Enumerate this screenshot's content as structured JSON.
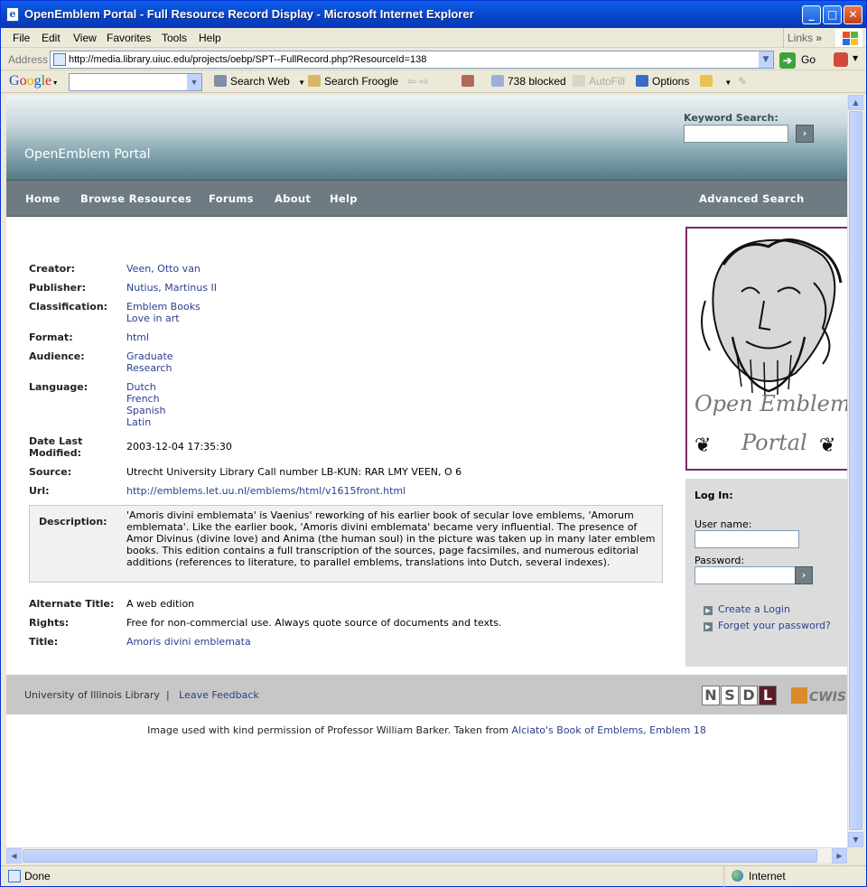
{
  "window": {
    "title": "OpenEmblem Portal - Full Resource Record Display - Microsoft Internet Explorer"
  },
  "menu": [
    "File",
    "Edit",
    "View",
    "Favorites",
    "Tools",
    "Help"
  ],
  "links_label": "Links",
  "address": {
    "label": "Address",
    "url": "http://media.library.uiuc.edu/projects/oebp/SPT--FullRecord.php?ResourceId=138",
    "go_label": "Go"
  },
  "google_toolbar": {
    "logo": "Google",
    "search_web": "Search Web",
    "search_froogle": "Search Froogle",
    "blocked": "738 blocked",
    "autofill": "AutoFill",
    "options": "Options"
  },
  "page": {
    "site_title": "OpenEmblem Portal",
    "keyword_search_label": "Keyword Search:",
    "nav": [
      "Home",
      "Browse Resources",
      "Forums",
      "About",
      "Help"
    ],
    "advanced_search": "Advanced Search",
    "record": {
      "creator_label": "Creator:",
      "creator": "Veen, Otto van",
      "publisher_label": "Publisher:",
      "publisher": "Nutius, Martinus II",
      "classification_label": "Classification:",
      "classification": [
        "Emblem Books",
        "Love in art"
      ],
      "format_label": "Format:",
      "format": "html",
      "audience_label": "Audience:",
      "audience": [
        "Graduate",
        "Research"
      ],
      "language_label": "Language:",
      "language": [
        "Dutch",
        "French",
        "Spanish",
        "Latin"
      ],
      "date_label_1": "Date Last",
      "date_label_2": "Modified:",
      "date": "2003-12-04 17:35:30",
      "source_label": "Source:",
      "source": "Utrecht University Library Call number LB-KUN: RAR LMY VEEN, O 6",
      "url_label": "Url:",
      "url": "http://emblems.let.uu.nl/emblems/html/v1615front.html",
      "description_label": "Description:",
      "description": "'Amoris divini emblemata' is Vaenius' reworking of his earlier book of secular love emblems, 'Amorum emblemata'. Like the earlier book, 'Amoris divini emblemata' became very influential. The presence of Amor Divinus (divine love) and Anima (the human soul) in the picture was taken up in many later emblem books. This edition contains a full transcription of the sources, page facsimiles, and numerous editorial additions (references to literature, to parallel emblems, translations into Dutch, several indexes).",
      "alt_title_label": "Alternate Title:",
      "alt_title": "A web edition",
      "rights_label": "Rights:",
      "rights": "Free for non-commercial use. Always quote source of documents and texts.",
      "title_label": "Title:",
      "title": "Amoris divini emblemata"
    },
    "emblem_text_1": "Open Emblem",
    "emblem_text_2": "Portal",
    "login": {
      "title": "Log In:",
      "username_label": "User name:",
      "password_label": "Password:",
      "create_login": "Create a Login",
      "forget_password": "Forget your password?"
    },
    "footer": {
      "org": "University of Illinois Library",
      "separator": "|",
      "feedback": "Leave Feedback",
      "nsdl_letters": [
        "N",
        "S",
        "D",
        "L"
      ],
      "cwis": "CWIS"
    },
    "credit": {
      "text": "Image used with kind permission of Professor William Barker. Taken from",
      "link": "Alciato's Book of Emblems, Emblem 18"
    }
  },
  "status": {
    "text": "Done",
    "zone": "Internet"
  }
}
